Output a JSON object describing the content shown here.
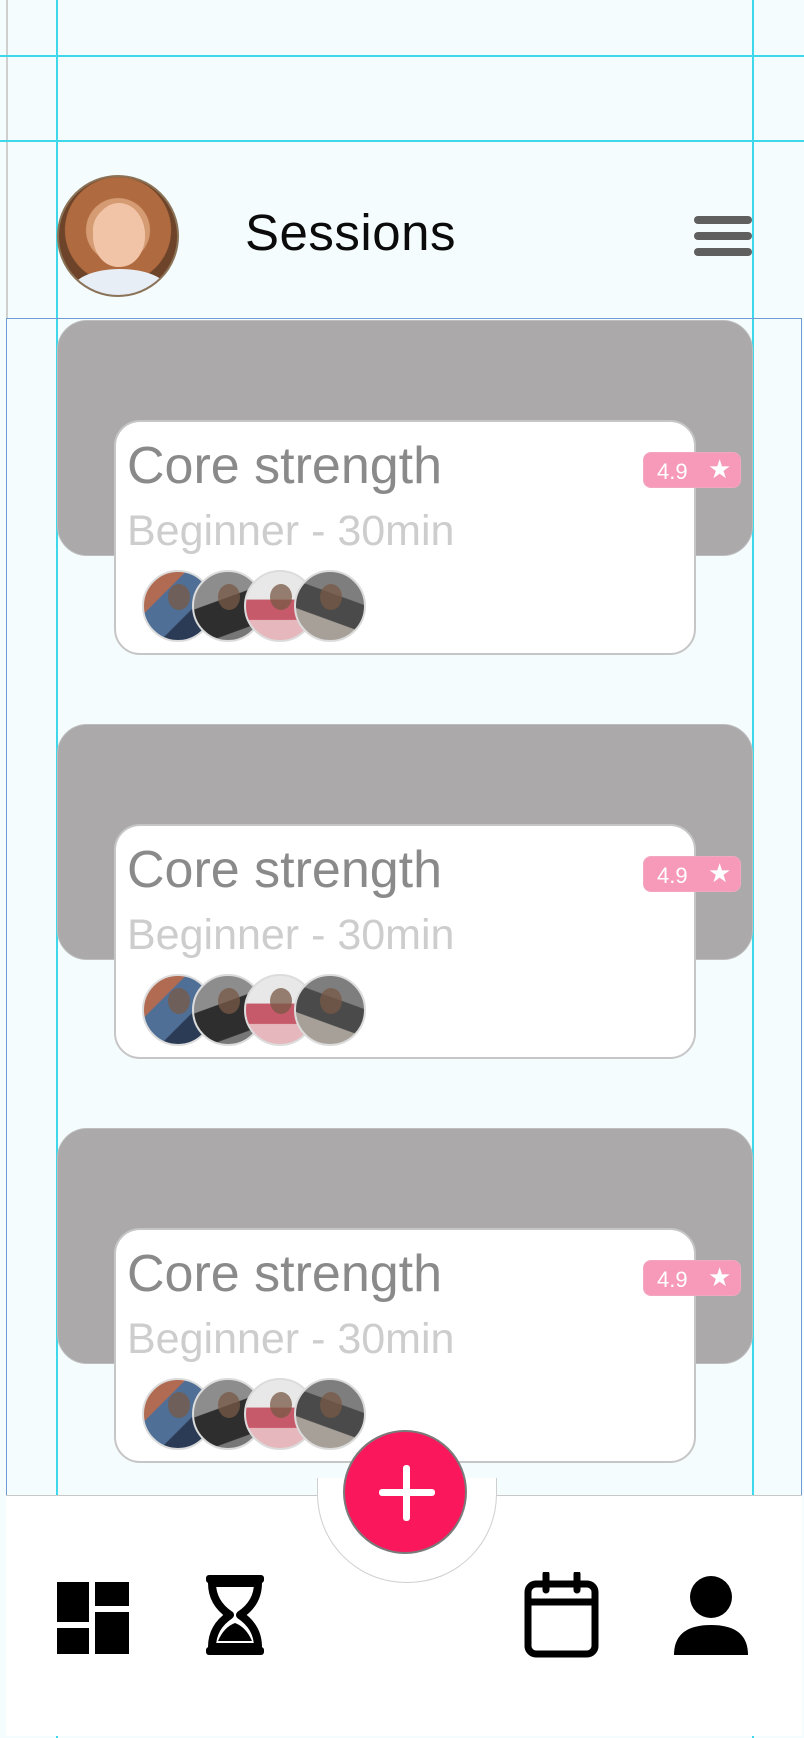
{
  "header": {
    "title": "Sessions"
  },
  "sessions": [
    {
      "title": "Core strength",
      "subtitle": "Beginner - 30min",
      "rating": "4.9"
    },
    {
      "title": "Core strength",
      "subtitle": "Beginner - 30min",
      "rating": "4.9"
    },
    {
      "title": "Core strength",
      "subtitle": "Beginner - 30min",
      "rating": "4.9"
    }
  ],
  "icons": {
    "menu": "hamburger-menu-icon",
    "rating": "star-icon",
    "add": "plus-icon",
    "nav": [
      "dashboard-icon",
      "hourglass-icon",
      "calendar-icon",
      "user-icon"
    ]
  },
  "colors": {
    "accent": "#fb175b",
    "rating_badge": "#f79aba",
    "card_backdrop": "#aba9a9",
    "background": "#f5fcfe"
  }
}
